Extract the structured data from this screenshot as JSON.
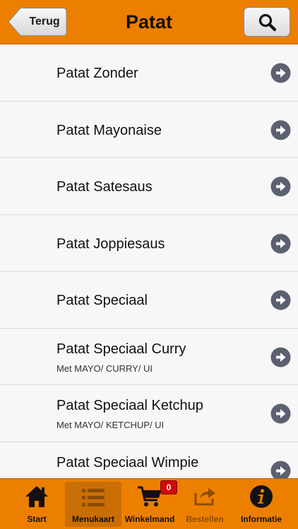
{
  "header": {
    "back_label": "Terug",
    "title": "Patat",
    "search_icon": "search-icon",
    "background": "#ed7f00"
  },
  "list": {
    "items": [
      {
        "title": "Patat Zonder",
        "subtitle": ""
      },
      {
        "title": "Patat Mayonaise",
        "subtitle": ""
      },
      {
        "title": "Patat Satesaus",
        "subtitle": ""
      },
      {
        "title": "Patat Joppiesaus",
        "subtitle": ""
      },
      {
        "title": "Patat Speciaal",
        "subtitle": ""
      },
      {
        "title": "Patat Speciaal Curry",
        "subtitle": "Met MAYO/ CURRY/ UI"
      },
      {
        "title": "Patat Speciaal Ketchup",
        "subtitle": "Met MAYO/ KETCHUP/ UI"
      },
      {
        "title": "Patat Speciaal Wimpie",
        "subtitle": ""
      }
    ],
    "chevron_icon": "chevron-right-circle-icon",
    "chevron_color": "#5b6170"
  },
  "tabbar": {
    "tabs": [
      {
        "label": "Start",
        "icon": "home-icon",
        "active": false
      },
      {
        "label": "Menukaart",
        "icon": "list-icon",
        "active": true
      },
      {
        "label": "Winkelmand",
        "icon": "cart-icon",
        "active": false
      },
      {
        "label": "Bestellen",
        "icon": "share-icon",
        "active": false,
        "disabled": true
      },
      {
        "label": "Informatie",
        "icon": "info-icon",
        "active": false
      }
    ],
    "cart_badge": "0",
    "badge_color": "#d10a0a"
  }
}
